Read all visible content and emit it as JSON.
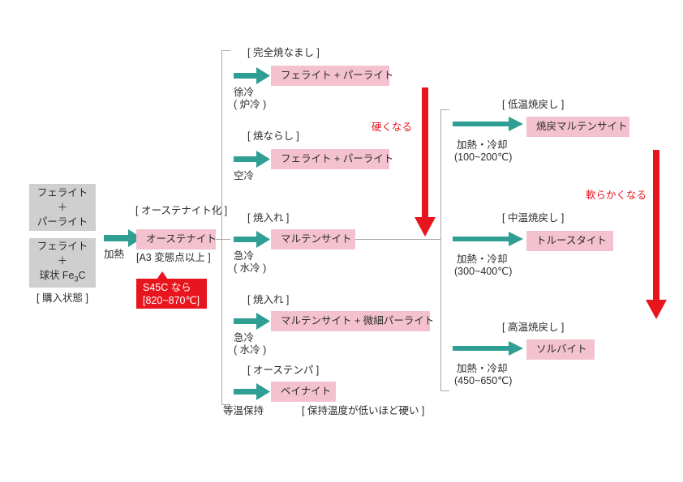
{
  "diagram": {
    "title_hidden": "",
    "colors": {
      "teal_arrow": "#2f9e93",
      "pink_box": "#f4c2cf",
      "gray_box": "#cfcfcf",
      "red_accent": "#e8151e",
      "bracket_line": "#a9a9a9",
      "text": "#2b2b2b"
    }
  },
  "start": {
    "box1_lines": [
      "フェライト",
      "＋",
      "パーライト"
    ],
    "box2_lines": [
      "フェライト",
      "＋",
      "球状 Fe3C"
    ],
    "box2_sub_main": "球状 Fe",
    "box2_sub_digit": "3",
    "box2_sub_tail": "C",
    "caption": "[ 購入状態 ]"
  },
  "austenitize": {
    "header": "[ オーステナイト化 ]",
    "arrow_label": "加熱",
    "result": "オーステナイト",
    "note": "[A3 変態点以上 ]",
    "callout_line1": "S45C なら",
    "callout_line2": "[820~870℃]"
  },
  "middle_branches": [
    {
      "header": "[ 完全焼なまし ]",
      "result": "フェライト + パーライト",
      "cool_line1": "徐冷",
      "cool_line2": "( 炉冷 )"
    },
    {
      "header": "[ 焼ならし ]",
      "result": "フェライト + パーライト",
      "cool_line1": "空冷",
      "cool_line2": ""
    },
    {
      "header": "[ 焼入れ ]",
      "result": "マルテンサイト",
      "cool_line1": "急冷",
      "cool_line2": "( 水冷 )"
    },
    {
      "header": "[ 焼入れ ]",
      "result": "マルテンサイト + 微細パーライト",
      "cool_line1": "急冷",
      "cool_line2": "( 水冷 )"
    },
    {
      "header": "[ オーステンパ ]",
      "result": "ベイナイト",
      "cool_line1": "等温保持",
      "cool_line2": ""
    }
  ],
  "middle_footnote": "[ 保持温度が低いほど硬い ]",
  "temper_branches": [
    {
      "header": "[ 低温焼戻し ]",
      "result": "焼戻マルテンサイト",
      "cond_line1": "加熱・冷却",
      "cond_line2": "(100~200℃)"
    },
    {
      "header": "[ 中温焼戻し ]",
      "result": "トルースタイト",
      "cond_line1": "加熱・冷却",
      "cond_line2": "(300~400℃)"
    },
    {
      "header": "[ 高温焼戻し ]",
      "result": "ソルバイト",
      "cond_line1": "加熱・冷却",
      "cond_line2": "(450~650℃)"
    }
  ],
  "trend_arrows": {
    "harder_label": "硬くなる",
    "softer_label": "軟らかくなる"
  }
}
